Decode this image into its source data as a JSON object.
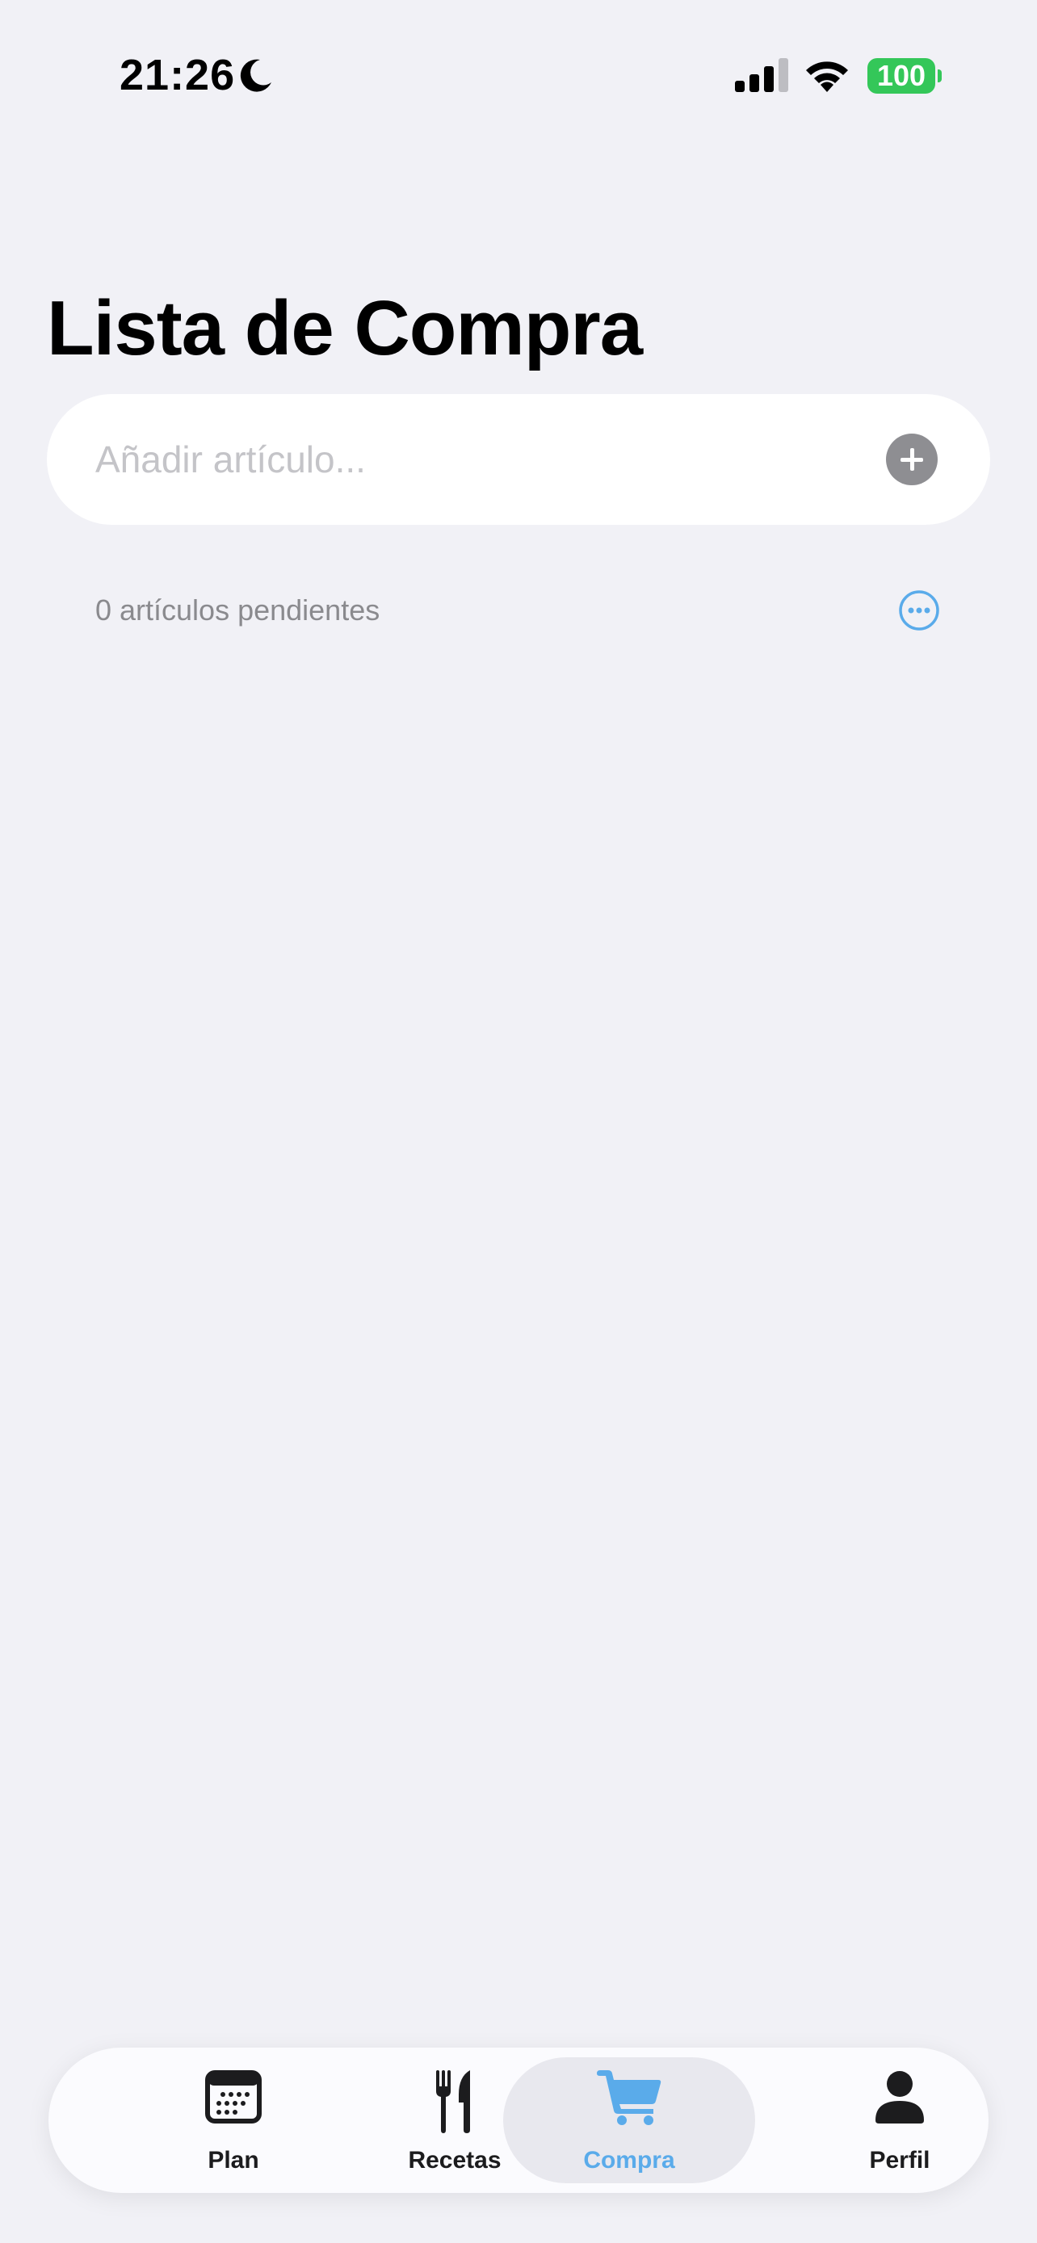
{
  "status_bar": {
    "time": "21:26",
    "battery": "100"
  },
  "colors": {
    "accent": "#5aabea",
    "battery": "#34c759",
    "background": "#f1f1f6"
  },
  "page": {
    "title": "Lista de Compra"
  },
  "add_field": {
    "placeholder": "Añadir artículo...",
    "value": "",
    "button_icon": "plus-circle-icon"
  },
  "list": {
    "pending_label": "0 artículos pendientes",
    "more_icon": "ellipsis-circle-icon"
  },
  "tab_bar": {
    "items": [
      {
        "label": "Plan",
        "icon": "calendar-icon",
        "active": false
      },
      {
        "label": "Recetas",
        "icon": "fork-knife-icon",
        "active": false
      },
      {
        "label": "Compra",
        "icon": "cart-icon",
        "active": true
      },
      {
        "label": "Perfil",
        "icon": "person-icon",
        "active": false
      }
    ]
  }
}
